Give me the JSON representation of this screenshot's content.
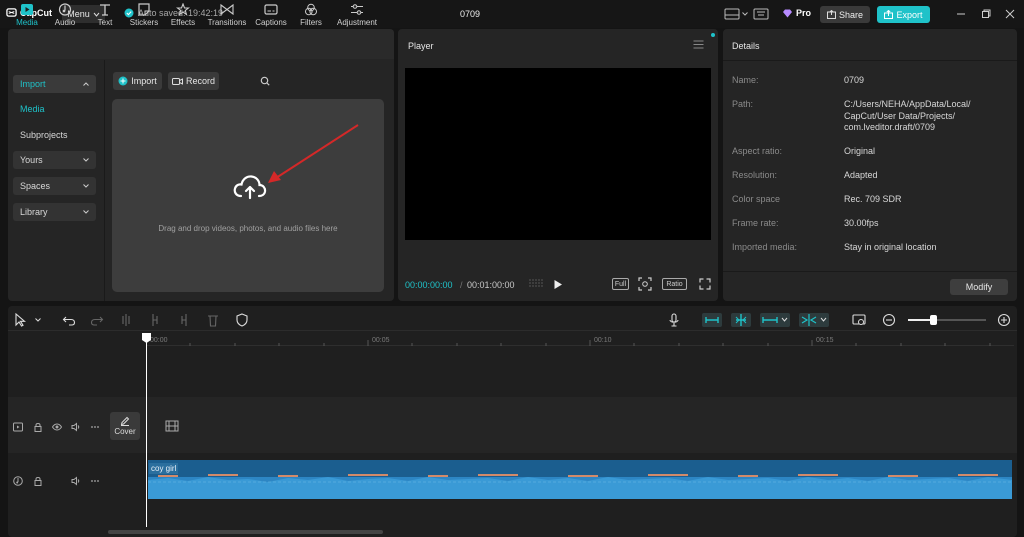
{
  "app": {
    "logo_text": "CapCut",
    "menu_label": "Menu",
    "autosave_text": "Auto saved: 19:42:19",
    "project_title": "0709",
    "pro_label": "Pro",
    "share_label": "Share",
    "export_label": "Export",
    "accent_color": "#1fc2c9"
  },
  "tabs": [
    {
      "label": "Media",
      "icon": "media-icon"
    },
    {
      "label": "Audio",
      "icon": "audio-icon"
    },
    {
      "label": "Text",
      "icon": "text-icon"
    },
    {
      "label": "Stickers",
      "icon": "stickers-icon"
    },
    {
      "label": "Effects",
      "icon": "effects-icon"
    },
    {
      "label": "Transitions",
      "icon": "transitions-icon"
    },
    {
      "label": "Captions",
      "icon": "captions-icon"
    },
    {
      "label": "Filters",
      "icon": "filters-icon"
    },
    {
      "label": "Adjustment",
      "icon": "adjustment-icon"
    }
  ],
  "sidebar": {
    "import": "Import",
    "media": "Media",
    "subprojects": "Subprojects",
    "yours": "Yours",
    "spaces": "Spaces",
    "library": "Library"
  },
  "media": {
    "import_label": "Import",
    "record_label": "Record",
    "drop_text": "Drag and drop videos, photos, and audio files here"
  },
  "player": {
    "title": "Player",
    "current_time": "00:00:00:00",
    "duration": "00:01:00:00",
    "full_label": "Full",
    "ratio_label": "Ratio"
  },
  "details": {
    "title": "Details",
    "rows": [
      {
        "label": "Name:",
        "value": "0709"
      },
      {
        "label": "Path:",
        "value": "C:/Users/NEHA/AppData/Local/ CapCut/User Data/Projects/ com.lveditor.draft/0709"
      },
      {
        "label": "Aspect ratio:",
        "value": "Original"
      },
      {
        "label": "Resolution:",
        "value": "Adapted"
      },
      {
        "label": "Color space",
        "value": "Rec. 709 SDR"
      },
      {
        "label": "Frame rate:",
        "value": "30.00fps"
      },
      {
        "label": "Imported media:",
        "value": "Stay in original location"
      }
    ],
    "modify_label": "Modify"
  },
  "timeline": {
    "ruler": [
      "00:00",
      "00:05",
      "00:10",
      "00:15"
    ],
    "cover_label": "Cover",
    "audio_clip_label": "coy girl"
  }
}
